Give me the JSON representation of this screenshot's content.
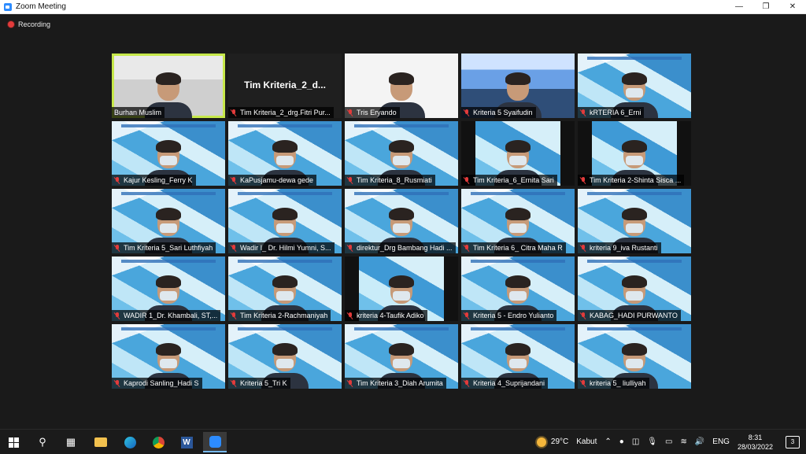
{
  "window": {
    "title": "Zoom Meeting"
  },
  "status": {
    "recording_label": "Recording"
  },
  "participants": [
    {
      "name": "Burhan Muslim",
      "bg": "office",
      "muted": false,
      "active": true
    },
    {
      "name": "Tim Kriteria_2_drg.Fitri Pur...",
      "bg": "black",
      "muted": true,
      "center": "Tim  Kriteria_2_d..."
    },
    {
      "name": "Tris Eryando",
      "bg": "white",
      "muted": true
    },
    {
      "name": "Kriteria 5 Syaifudin",
      "bg": "hall",
      "muted": true
    },
    {
      "name": "kRTERIA 6_Erni",
      "bg": "banner",
      "muted": true
    },
    {
      "name": "Kajur Kesling_Ferry K",
      "bg": "banner",
      "muted": true
    },
    {
      "name": "KaPusjamu-dewa gede",
      "bg": "banner",
      "muted": true
    },
    {
      "name": "Tim Kriteria_8_Rusmiati",
      "bg": "banner",
      "muted": true
    },
    {
      "name": "Tim Kriteria_6_Ernita Sari",
      "bg": "darkbanner",
      "muted": true
    },
    {
      "name": "Tim Kriteria 2-Shinta Sisca ...",
      "bg": "darkbanner",
      "muted": true
    },
    {
      "name": "Tim Kriteria 5_Sari Luthfiyah",
      "bg": "banner",
      "muted": true
    },
    {
      "name": "Wadir I_ Dr. Hilmi Yumni, S...",
      "bg": "banner",
      "muted": true
    },
    {
      "name": "direktur_Drg Bambang Hadi ...",
      "bg": "banner",
      "muted": true
    },
    {
      "name": "Tim Kriteria 6_ Citra Maha R",
      "bg": "banner",
      "muted": true
    },
    {
      "name": "kriteria 9_iva Rustanti",
      "bg": "banner",
      "muted": true
    },
    {
      "name": "WADIR 1_Dr. Khambali, ST,...",
      "bg": "banner",
      "muted": true
    },
    {
      "name": "Tim Kriteria 2-Rachmaniyah",
      "bg": "banner",
      "muted": true
    },
    {
      "name": "kriteria 4-Taufik Adiko",
      "bg": "darkbanner",
      "muted": true
    },
    {
      "name": "Kriteria 5 - Endro Yulianto",
      "bg": "banner",
      "muted": true
    },
    {
      "name": "KABAG_HADI PURWANTO",
      "bg": "banner",
      "muted": true
    },
    {
      "name": "Kaprodi Sanling_Hadi S",
      "bg": "banner",
      "muted": true
    },
    {
      "name": "Kriteria 5_Tri K",
      "bg": "banner",
      "muted": true
    },
    {
      "name": "Tim Kriteria 3_Diah Arumita",
      "bg": "banner",
      "muted": true
    },
    {
      "name": "Kriteria 4_Suprijandani",
      "bg": "banner",
      "muted": true
    },
    {
      "name": "kriteria 5_ liulliyah",
      "bg": "banner",
      "muted": true
    }
  ],
  "taskbar": {
    "weather_temp": "29°C",
    "weather_desc": "Kabut",
    "language": "ENG",
    "time": "8:31",
    "date": "28/03/2022",
    "notification_count": "3",
    "apps": [
      "start",
      "search",
      "task-view",
      "file-explorer",
      "edge",
      "chrome",
      "word",
      "zoom"
    ]
  }
}
